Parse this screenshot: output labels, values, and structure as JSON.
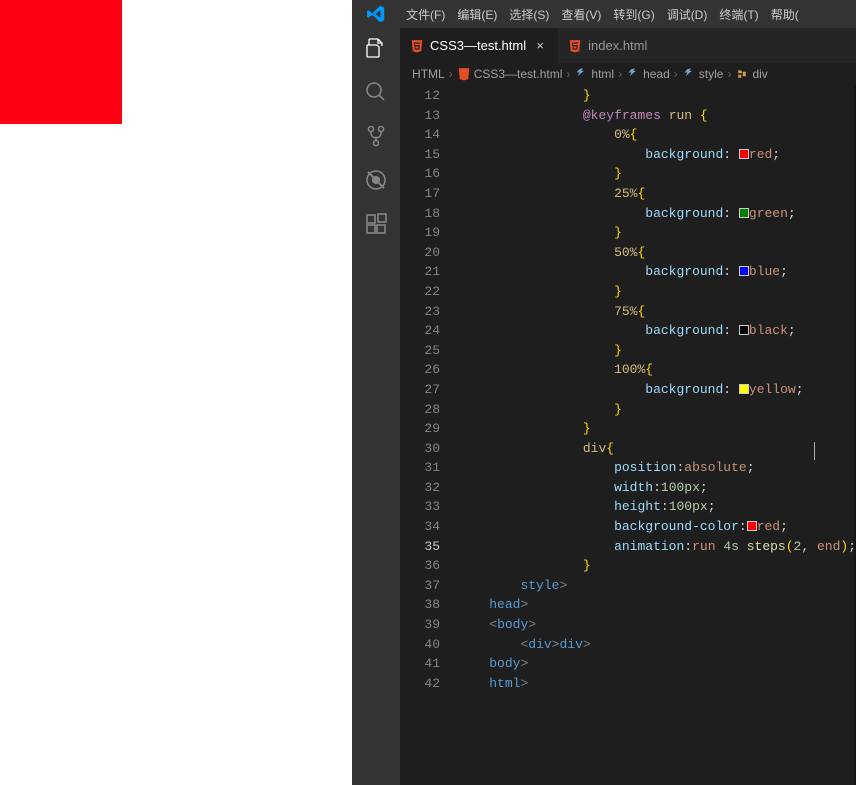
{
  "browser": {
    "square_color": "#ff0013"
  },
  "menubar": {
    "items": [
      "文件(F)",
      "编辑(E)",
      "选择(S)",
      "查看(V)",
      "转到(G)",
      "调试(D)",
      "终端(T)",
      "帮助("
    ]
  },
  "tabs": [
    {
      "label": "CSS3—test.html",
      "active": true
    },
    {
      "label": "index.html",
      "active": false
    }
  ],
  "breadcrumbs": [
    "HTML",
    "CSS3—test.html",
    "html",
    "head",
    "style",
    "div"
  ],
  "gutter": {
    "start": 12,
    "end": 42,
    "current": 35
  },
  "code_lines": [
    {
      "n": 12,
      "indent": 16,
      "tokens": [
        {
          "t": "brace",
          "v": "}"
        }
      ]
    },
    {
      "n": 13,
      "indent": 16,
      "tokens": [
        {
          "t": "at",
          "v": "@keyframes "
        },
        {
          "t": "name",
          "v": "run "
        },
        {
          "t": "brace",
          "v": "{"
        }
      ]
    },
    {
      "n": 14,
      "indent": 20,
      "tokens": [
        {
          "t": "name",
          "v": "0%"
        },
        {
          "t": "brace",
          "v": "{"
        }
      ]
    },
    {
      "n": 15,
      "indent": 24,
      "tokens": [
        {
          "t": "prop",
          "v": "background"
        },
        {
          "t": "punc",
          "v": ": "
        },
        {
          "t": "swatch",
          "v": "#ff0000"
        },
        {
          "t": "val",
          "v": "red"
        },
        {
          "t": "punc",
          "v": ";"
        }
      ]
    },
    {
      "n": 16,
      "indent": 20,
      "tokens": [
        {
          "t": "brace",
          "v": "}"
        }
      ]
    },
    {
      "n": 17,
      "indent": 20,
      "tokens": [
        {
          "t": "name",
          "v": "25%"
        },
        {
          "t": "brace",
          "v": "{"
        }
      ]
    },
    {
      "n": 18,
      "indent": 24,
      "tokens": [
        {
          "t": "prop",
          "v": "background"
        },
        {
          "t": "punc",
          "v": ": "
        },
        {
          "t": "swatch",
          "v": "#008000"
        },
        {
          "t": "val",
          "v": "green"
        },
        {
          "t": "punc",
          "v": ";"
        }
      ]
    },
    {
      "n": 19,
      "indent": 20,
      "tokens": [
        {
          "t": "brace",
          "v": "}"
        }
      ]
    },
    {
      "n": 20,
      "indent": 20,
      "tokens": [
        {
          "t": "name",
          "v": "50%"
        },
        {
          "t": "brace",
          "v": "{"
        }
      ]
    },
    {
      "n": 21,
      "indent": 24,
      "tokens": [
        {
          "t": "prop",
          "v": "background"
        },
        {
          "t": "punc",
          "v": ": "
        },
        {
          "t": "swatch",
          "v": "#0000ff"
        },
        {
          "t": "val",
          "v": "blue"
        },
        {
          "t": "punc",
          "v": ";"
        }
      ]
    },
    {
      "n": 22,
      "indent": 20,
      "tokens": [
        {
          "t": "brace",
          "v": "}"
        }
      ]
    },
    {
      "n": 23,
      "indent": 20,
      "tokens": [
        {
          "t": "name",
          "v": "75%"
        },
        {
          "t": "brace",
          "v": "{"
        }
      ]
    },
    {
      "n": 24,
      "indent": 24,
      "tokens": [
        {
          "t": "prop",
          "v": "background"
        },
        {
          "t": "punc",
          "v": ": "
        },
        {
          "t": "swatch",
          "v": "#000000"
        },
        {
          "t": "val",
          "v": "black"
        },
        {
          "t": "punc",
          "v": ";"
        }
      ]
    },
    {
      "n": 25,
      "indent": 20,
      "tokens": [
        {
          "t": "brace",
          "v": "}"
        }
      ]
    },
    {
      "n": 26,
      "indent": 20,
      "tokens": [
        {
          "t": "name",
          "v": "100%"
        },
        {
          "t": "brace",
          "v": "{"
        }
      ]
    },
    {
      "n": 27,
      "indent": 24,
      "tokens": [
        {
          "t": "prop",
          "v": "background"
        },
        {
          "t": "punc",
          "v": ": "
        },
        {
          "t": "swatch",
          "v": "#ffff00"
        },
        {
          "t": "val",
          "v": "yellow"
        },
        {
          "t": "punc",
          "v": ";"
        }
      ]
    },
    {
      "n": 28,
      "indent": 20,
      "tokens": [
        {
          "t": "brace",
          "v": "}"
        }
      ]
    },
    {
      "n": 29,
      "indent": 16,
      "tokens": [
        {
          "t": "brace",
          "v": "}"
        }
      ]
    },
    {
      "n": 30,
      "indent": 16,
      "tokens": [
        {
          "t": "name",
          "v": "div"
        },
        {
          "t": "brace",
          "v": "{"
        }
      ]
    },
    {
      "n": 31,
      "indent": 20,
      "tokens": [
        {
          "t": "prop",
          "v": "position"
        },
        {
          "t": "punc",
          "v": ":"
        },
        {
          "t": "val",
          "v": "absolute"
        },
        {
          "t": "punc",
          "v": ";"
        }
      ]
    },
    {
      "n": 32,
      "indent": 20,
      "tokens": [
        {
          "t": "prop",
          "v": "width"
        },
        {
          "t": "punc",
          "v": ":"
        },
        {
          "t": "num",
          "v": "100px"
        },
        {
          "t": "punc",
          "v": ";"
        }
      ]
    },
    {
      "n": 33,
      "indent": 20,
      "tokens": [
        {
          "t": "prop",
          "v": "height"
        },
        {
          "t": "punc",
          "v": ":"
        },
        {
          "t": "num",
          "v": "100px"
        },
        {
          "t": "punc",
          "v": ";"
        }
      ]
    },
    {
      "n": 34,
      "indent": 20,
      "tokens": [
        {
          "t": "prop",
          "v": "background-color"
        },
        {
          "t": "punc",
          "v": ":"
        },
        {
          "t": "swatch",
          "v": "#ff0000"
        },
        {
          "t": "val",
          "v": "red"
        },
        {
          "t": "punc",
          "v": ";"
        }
      ]
    },
    {
      "n": 35,
      "indent": 20,
      "tokens": [
        {
          "t": "prop",
          "v": "animation"
        },
        {
          "t": "punc",
          "v": ":"
        },
        {
          "t": "val",
          "v": "run "
        },
        {
          "t": "num",
          "v": "4s "
        },
        {
          "t": "func",
          "v": "steps"
        },
        {
          "t": "brace",
          "v": "("
        },
        {
          "t": "num",
          "v": "2"
        },
        {
          "t": "punc",
          "v": ", "
        },
        {
          "t": "val",
          "v": "end"
        },
        {
          "t": "brace",
          "v": ")"
        },
        {
          "t": "punc",
          "v": ";"
        }
      ]
    },
    {
      "n": 36,
      "indent": 16,
      "tokens": [
        {
          "t": "brace",
          "v": "}"
        }
      ]
    },
    {
      "n": 37,
      "indent": 8,
      "tokens": [
        {
          "t": "angle",
          "v": "</"
        },
        {
          "t": "tag",
          "v": "style"
        },
        {
          "t": "angle",
          "v": ">"
        }
      ]
    },
    {
      "n": 38,
      "indent": 4,
      "tokens": [
        {
          "t": "angle",
          "v": "</"
        },
        {
          "t": "tag",
          "v": "head"
        },
        {
          "t": "angle",
          "v": ">"
        }
      ]
    },
    {
      "n": 39,
      "indent": 4,
      "tokens": [
        {
          "t": "angle",
          "v": "<"
        },
        {
          "t": "tag",
          "v": "body"
        },
        {
          "t": "angle",
          "v": ">"
        }
      ]
    },
    {
      "n": 40,
      "indent": 8,
      "tokens": [
        {
          "t": "angle",
          "v": "<"
        },
        {
          "t": "tag",
          "v": "div"
        },
        {
          "t": "angle",
          "v": "></"
        },
        {
          "t": "tag",
          "v": "div"
        },
        {
          "t": "angle",
          "v": ">"
        }
      ]
    },
    {
      "n": 41,
      "indent": 4,
      "tokens": [
        {
          "t": "angle",
          "v": "</"
        },
        {
          "t": "tag",
          "v": "body"
        },
        {
          "t": "angle",
          "v": ">"
        }
      ]
    },
    {
      "n": 42,
      "indent": 4,
      "tokens": [
        {
          "t": "angle",
          "v": "</"
        },
        {
          "t": "tag",
          "v": "html"
        },
        {
          "t": "angle",
          "v": ">"
        }
      ]
    }
  ]
}
